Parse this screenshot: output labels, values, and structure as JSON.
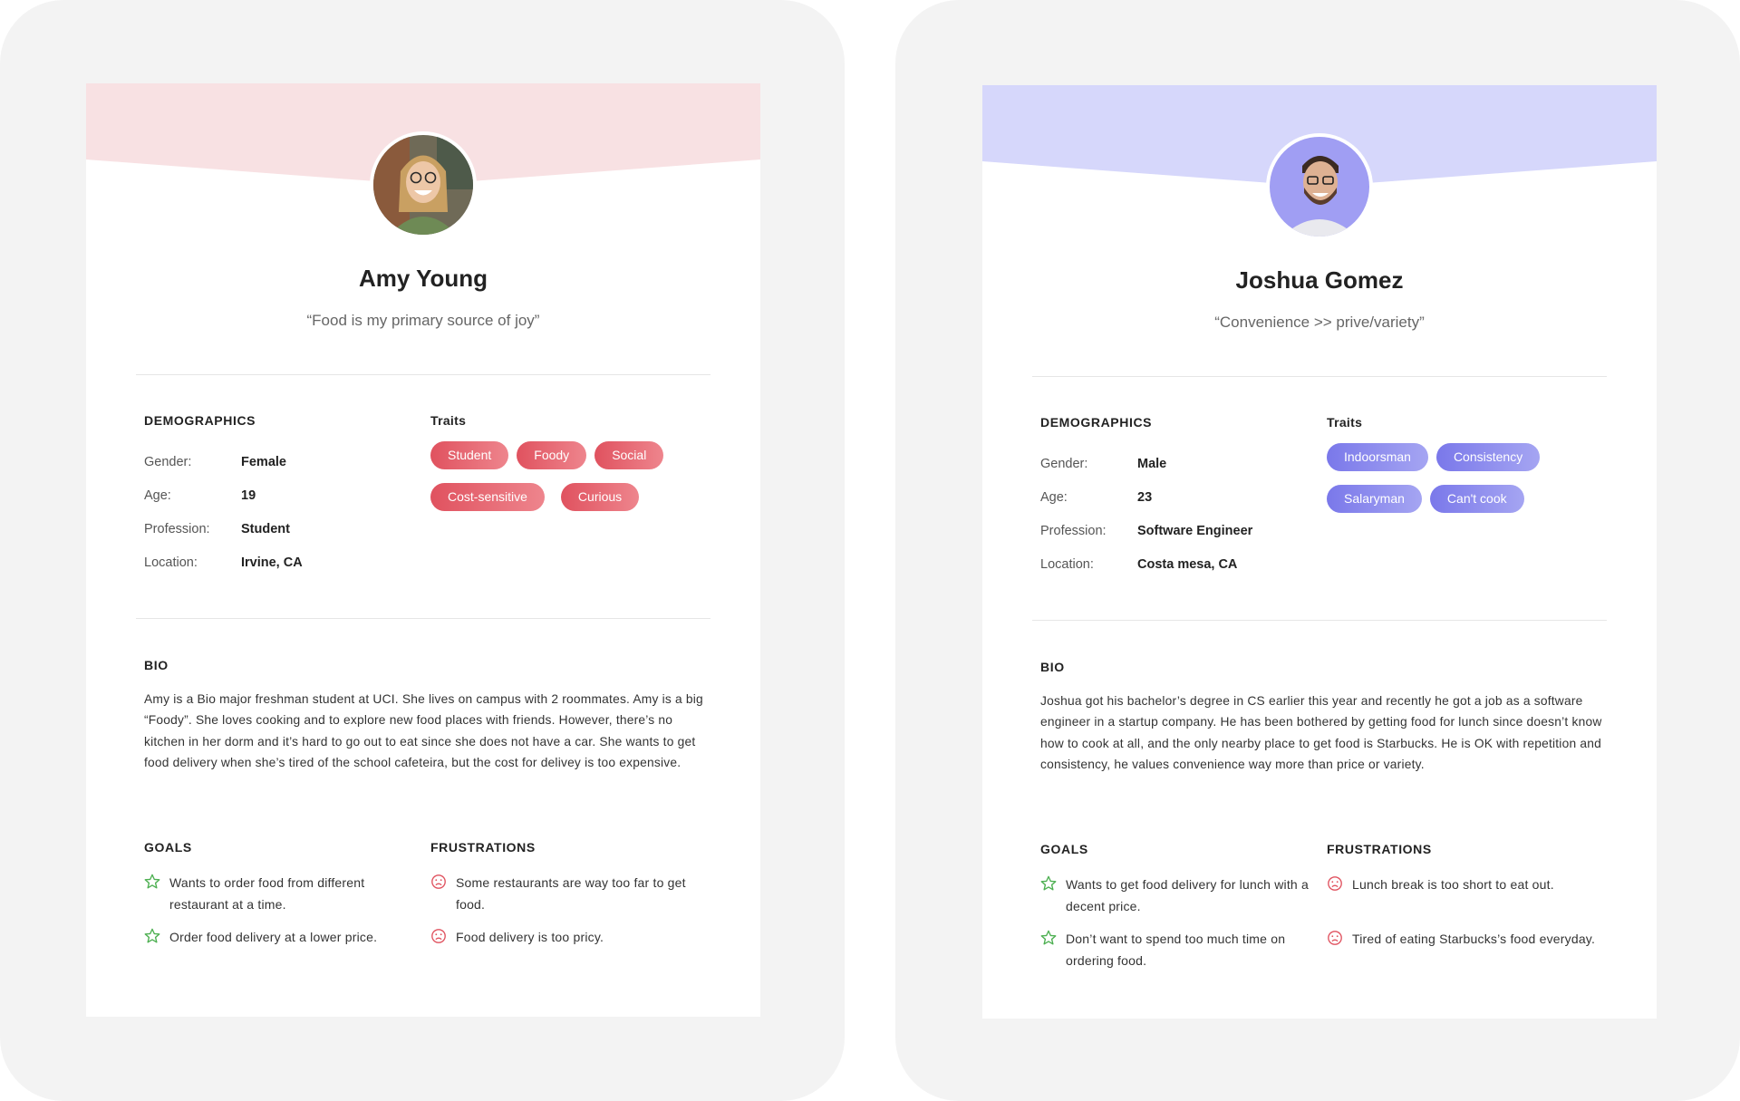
{
  "personas": [
    {
      "name": "Amy Young",
      "quote": "“Food is my primary source of joy”",
      "banner_color": "#f8e1e3",
      "accent": "#e3585f",
      "demographics_title": "DEMOGRAPHICS",
      "demographics": [
        {
          "label": "Gender:",
          "value": "Female"
        },
        {
          "label": "Age:",
          "value": "19"
        },
        {
          "label": "Profession:",
          "value": "Student"
        },
        {
          "label": "Location:",
          "value": "Irvine, CA"
        }
      ],
      "traits_title": "Traits",
      "traits": [
        "Student",
        "Foody",
        "Social",
        "Cost-sensitive",
        "Curious"
      ],
      "bio_title": "BIO",
      "bio": "Amy is a Bio major freshman student at UCI. She lives on campus with 2 roommates. Amy is a big “Foody”. She loves cooking and to explore new food places with friends. However, there’s no kitchen in her dorm and it’s hard to go out to eat since she does not have a car. She wants to get food delivery when she’s tired of the school cafeteira, but the cost for delivey is too expensive.",
      "goals_title": "GOALS",
      "goals": [
        "Wants to order food from different restaurant at a time.",
        "Order food delivery at a lower price."
      ],
      "frustrations_title": "FRUSTRATIONS",
      "frustrations": [
        "Some restaurants are way too far to get food.",
        "Food delivery is too pricy."
      ]
    },
    {
      "name": "Joshua Gomez",
      "quote": "“Convenience >> prive/variety”",
      "banner_color": "#d6d7fb",
      "accent": "#7b79ea",
      "demographics_title": "DEMOGRAPHICS",
      "demographics": [
        {
          "label": "Gender:",
          "value": "Male"
        },
        {
          "label": "Age:",
          "value": "23"
        },
        {
          "label": "Profession:",
          "value": "Software Engineer"
        },
        {
          "label": "Location:",
          "value": "Costa mesa, CA"
        }
      ],
      "traits_title": "Traits",
      "traits": [
        "Indoorsman",
        "Consistency",
        "Salaryman",
        "Can't cook"
      ],
      "bio_title": "BIO",
      "bio": "Joshua got his bachelor’s degree in CS earlier this year and recently he got a job as a software engineer in a startup company. He has been bothered by getting food for lunch since doesn’t know how to cook at all, and the only nearby place to get food is Starbucks. He is OK with repetition and consistency, he values convenience way more than price or variety.",
      "goals_title": "GOALS",
      "goals": [
        "Wants to get food delivery for lunch with a decent price.",
        "Don’t want to spend too much time on ordering food."
      ],
      "frustrations_title": "FRUSTRATIONS",
      "frustrations": [
        "Lunch break is too short to eat out.",
        "Tired of eating Starbucks’s food everyday."
      ]
    }
  ],
  "icons": {
    "goal": "star-outline-icon",
    "frustration": "sad-face-icon"
  },
  "colors": {
    "goal_icon": "#4caf50",
    "frustration_icon": "#e0525f"
  }
}
